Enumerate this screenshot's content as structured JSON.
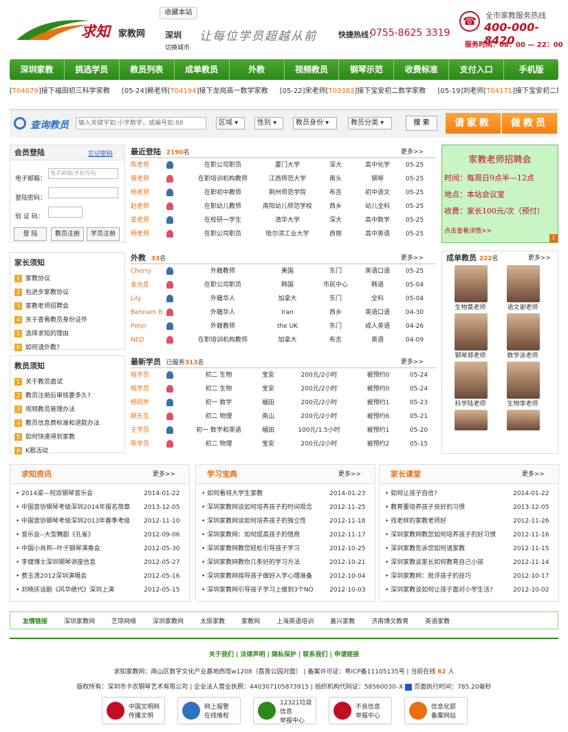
{
  "header": {
    "site_name": "求知",
    "site_sub": "家教网",
    "bookmark": "收藏本站",
    "city": "深圳",
    "city_switch": "切换城市",
    "slogan": "让每位学员超越从前",
    "hotline_label": "快捷热线：",
    "hotline": "0755-8625 3319",
    "service_label": "全市家教服务热线",
    "service_number": "400-000-8420",
    "service_time": "服务时间：08：00 — 22：00"
  },
  "nav": [
    "深圳家教",
    "挑选学员",
    "教员列表",
    "成单教员",
    "外教",
    "视频教员",
    "钢琴示范",
    "收费标准",
    "支付入口",
    "手机版"
  ],
  "ticker": [
    {
      "pre": "[",
      "code": "T04079",
      "post": "]接下福田初三科学家教"
    },
    {
      "pre": "[05-24]赖老师[",
      "code": "T04194",
      "post": "]接下龙岗高一数学家教"
    },
    {
      "pre": "[05-22]宋老师[",
      "code": "T03383",
      "post": "]接下宝安初二数学家教"
    },
    {
      "pre": "[05-19]刘老师[",
      "code": "T04171",
      "post": "]接下宝安初二数学家教"
    }
  ],
  "search": {
    "title": "查询教员",
    "placeholder": "输入关键字如:小学数学，或编号如:88",
    "filters": [
      "区域",
      "性别",
      "教员身份",
      "教员分类"
    ],
    "button": "搜 索",
    "hire": "请家教",
    "tutor": "做教员"
  },
  "login": {
    "title": "会员登陆",
    "forgot": "忘记密码",
    "email_label": "电子邮箱：",
    "email_placeholder": "电子邮箱/手机号码",
    "password_label": "登陆密码：",
    "code_label": "验 证 码：",
    "login_btn": "登 陆",
    "reg_teacher": "教员注册",
    "reg_student": "学员注册"
  },
  "parent_notes": {
    "title": "家长须知",
    "items": [
      "家教协议",
      "包进步家教协议",
      "家教老师招聘会",
      "关于查看教员身份证件",
      "选择求知的理由",
      "如何请外教?"
    ]
  },
  "teacher_notes": {
    "title": "教员须知",
    "items": [
      "关于教员面试",
      "教员注册后审核要多久?",
      "视频教员管理办法",
      "教员信息费标准和退款办法",
      "如何快速得到家教",
      "K歌活动"
    ]
  },
  "recent": {
    "title": "最近登陆",
    "count": "2190",
    "unit": "名",
    "more": "更多>>",
    "rows": [
      [
        "陈老师",
        "在职公司职员",
        "厦门大学",
        "深大",
        "高中化学",
        "05-25"
      ],
      [
        "管老师",
        "在职培训机构教师",
        "江西师范大学",
        "南头",
        "钢琴",
        "05-25"
      ],
      [
        "杨老师",
        "在职初中教师",
        "荆州师范学院",
        "布吉",
        "初中语文",
        "05-25"
      ],
      [
        "赵老师",
        "在职幼儿教师",
        "南阳幼儿师范学校",
        "西乡",
        "幼儿全科",
        "05-25"
      ],
      [
        "姜老师",
        "在校研一学生",
        "清华大学",
        "深大",
        "高中数学",
        "05-25"
      ],
      [
        "杨老师",
        "在职公司职员",
        "哈尔滨工业大学",
        "西丽",
        "高中英语",
        "05-25"
      ]
    ]
  },
  "foreign": {
    "title": "外教",
    "count": "33",
    "unit": "名",
    "more": "更多>>",
    "rows": [
      [
        "Cherry",
        "外籍教师",
        "美国",
        "东门",
        "英语口语",
        "05-25"
      ],
      [
        "金允息",
        "在职公司职员",
        "韩国",
        "市民中心",
        "韩语",
        "05-04"
      ],
      [
        "Lily",
        "外籍华人",
        "加拿大",
        "东门",
        "全科",
        "05-04"
      ],
      [
        "Behnam B",
        "外籍华人",
        "Iran",
        "西乡",
        "英语口语",
        "04-30"
      ],
      [
        "Peter",
        "外籍教师",
        "the UK",
        "东门",
        "成人英语",
        "04-26"
      ],
      [
        "NED",
        "在职培训机构教师",
        "加拿大",
        "布吉",
        "英语",
        "04-09"
      ]
    ]
  },
  "students": {
    "title": "最新学员",
    "prefix": "已服务",
    "count": "313",
    "unit": "名",
    "more": "更多>>",
    "rows": [
      [
        "程学员",
        "初二 生物",
        "宝安",
        "200元/2小时",
        "被预约0",
        "05-24"
      ],
      [
        "程学员",
        "初二 生物",
        "宝安",
        "200元/2小时",
        "被预约0",
        "05-24"
      ],
      [
        "杨同学",
        "初一 数学",
        "福田",
        "200元/2小时",
        "被预约1",
        "05-23"
      ],
      [
        "姚先生",
        "初二 物理",
        "南山",
        "200元/2小时",
        "被预约6",
        "05-21"
      ],
      [
        "王学员",
        "初一 数学和英语",
        "福田",
        "100元/1.5小时",
        "被预约1",
        "05-20"
      ],
      [
        "陈学员",
        "初二 物理",
        "宝安",
        "200元/2小时",
        "被预约2",
        "05-15"
      ]
    ]
  },
  "recruit": {
    "title": "家教老师招聘会",
    "time": "时间：每周日9点半—12点",
    "place": "地点：本站会议室",
    "fee": "收费：家长100元/次（预付）",
    "link": "点击查看详情>>",
    "page": "1"
  },
  "tutors": {
    "title": "成单教员",
    "count": "222",
    "unit": "名",
    "more": "更多>>",
    "items": [
      "生物莫老师",
      "语文谢老师",
      "钢琴郑老师",
      "数学涂老师",
      "科学陆老师",
      "生物李老师",
      "",
      ""
    ]
  },
  "news": {
    "title": "求知资讯",
    "more": "更多>>",
    "rows": [
      [
        "2014梁—何双钢琴音乐会",
        "2014-01-22"
      ],
      [
        "中国音协钢琴考级深圳2014年报名简章",
        "2013-12-05"
      ],
      [
        "中国音协钢琴考级深圳2013年春季考级",
        "2012-11-10"
      ],
      [
        "音乐会--大型舞剧《孔雀》",
        "2012-09-06"
      ],
      [
        "中国小肖邦--叶子钢琴演奏会",
        "2012-05-30"
      ],
      [
        "李健博士深圳钢琴讲座信息",
        "2012-05-27"
      ],
      [
        "费玉清2012深圳演唱会",
        "2012-05-16"
      ],
      [
        "刘晓庆话剧《风华绝代》深圳上演",
        "2012-05-15"
      ]
    ]
  },
  "study": {
    "title": "学习宝典",
    "more": "更多>>",
    "rows": [
      [
        "如何看待大学生家教",
        "2014-01-23"
      ],
      [
        "深圳家教网谈如何培养孩子的时间观念",
        "2012-11-25"
      ],
      [
        "深圳家教网谈如何培养孩子的独立性",
        "2012-11-18"
      ],
      [
        "深圳家教网：如何提高孩子的情商",
        "2012-11-17"
      ],
      [
        "深圳家教网教您轻松引导孩子学习",
        "2012-10-25"
      ],
      [
        "深圳家教网教你几条好的学习方法",
        "2012-10-21"
      ],
      [
        "深圳家教网指导孩子做好入学心理准备",
        "2012-10-04"
      ],
      [
        "深圳家教网引导孩子学习上做到3个NO",
        "2012-10-03"
      ]
    ]
  },
  "parents": {
    "title": "家长课堂",
    "more": "更多>>",
    "rows": [
      [
        "如何让孩子自信?",
        "2014-01-22"
      ],
      [
        "教育要培养孩子良好的习惯",
        "2013-12-05"
      ],
      [
        "找老样的家教老师好",
        "2012-11-26"
      ],
      [
        "深圳家教网教您如何培养孩子的好习惯",
        "2012-11-16"
      ],
      [
        "深圳家教告诉您如何请家教",
        "2012-11-15"
      ],
      [
        "深圳家教谈家长如何教育自己小孩",
        "2012-11-14"
      ],
      [
        "深圳家教网：批评孩子的技巧",
        "2012-10-17"
      ],
      [
        "深圳家教谈如何让孩子面对小学生活?",
        "2012-10-02"
      ]
    ]
  },
  "links": {
    "title": "友情链接",
    "items": [
      "深圳家教网",
      "艺琼网络",
      "深圳家教网",
      "太原家教",
      "家教网",
      "上海英语培训",
      "嘉兴家教",
      "济南博文教育",
      "英语家教"
    ]
  },
  "footer": {
    "nav": "关于我们 | 法律声明 | 隐私保护 | 联系我们 | 申请链接",
    "line1_pre": "求知家教网：南山区数字文化产业基地西塔w1208（荔香公园对面） | 备案许可证：粤ICP备11105135号 | 当前在线",
    "online": "62",
    "line1_post": "人",
    "line2": "版权所有：深圳市卡农钢琴艺术有限公司 | 企业法人营业执照：440307105873915 | 组织机构代码证：58560030–X",
    "line2_post": "页面执行时间：785.20毫秒",
    "badges": [
      [
        "中国文明网",
        "传播文明"
      ],
      [
        "网上报警",
        "在线维权"
      ],
      [
        "12321垃圾信息",
        "举报中心"
      ],
      [
        "不良信息",
        "举报中心"
      ],
      [
        "信息化部",
        "备案网站"
      ]
    ]
  },
  "colors": {
    "green": "#2b8a17",
    "orange": "#e96f10",
    "red": "#c30d23"
  }
}
